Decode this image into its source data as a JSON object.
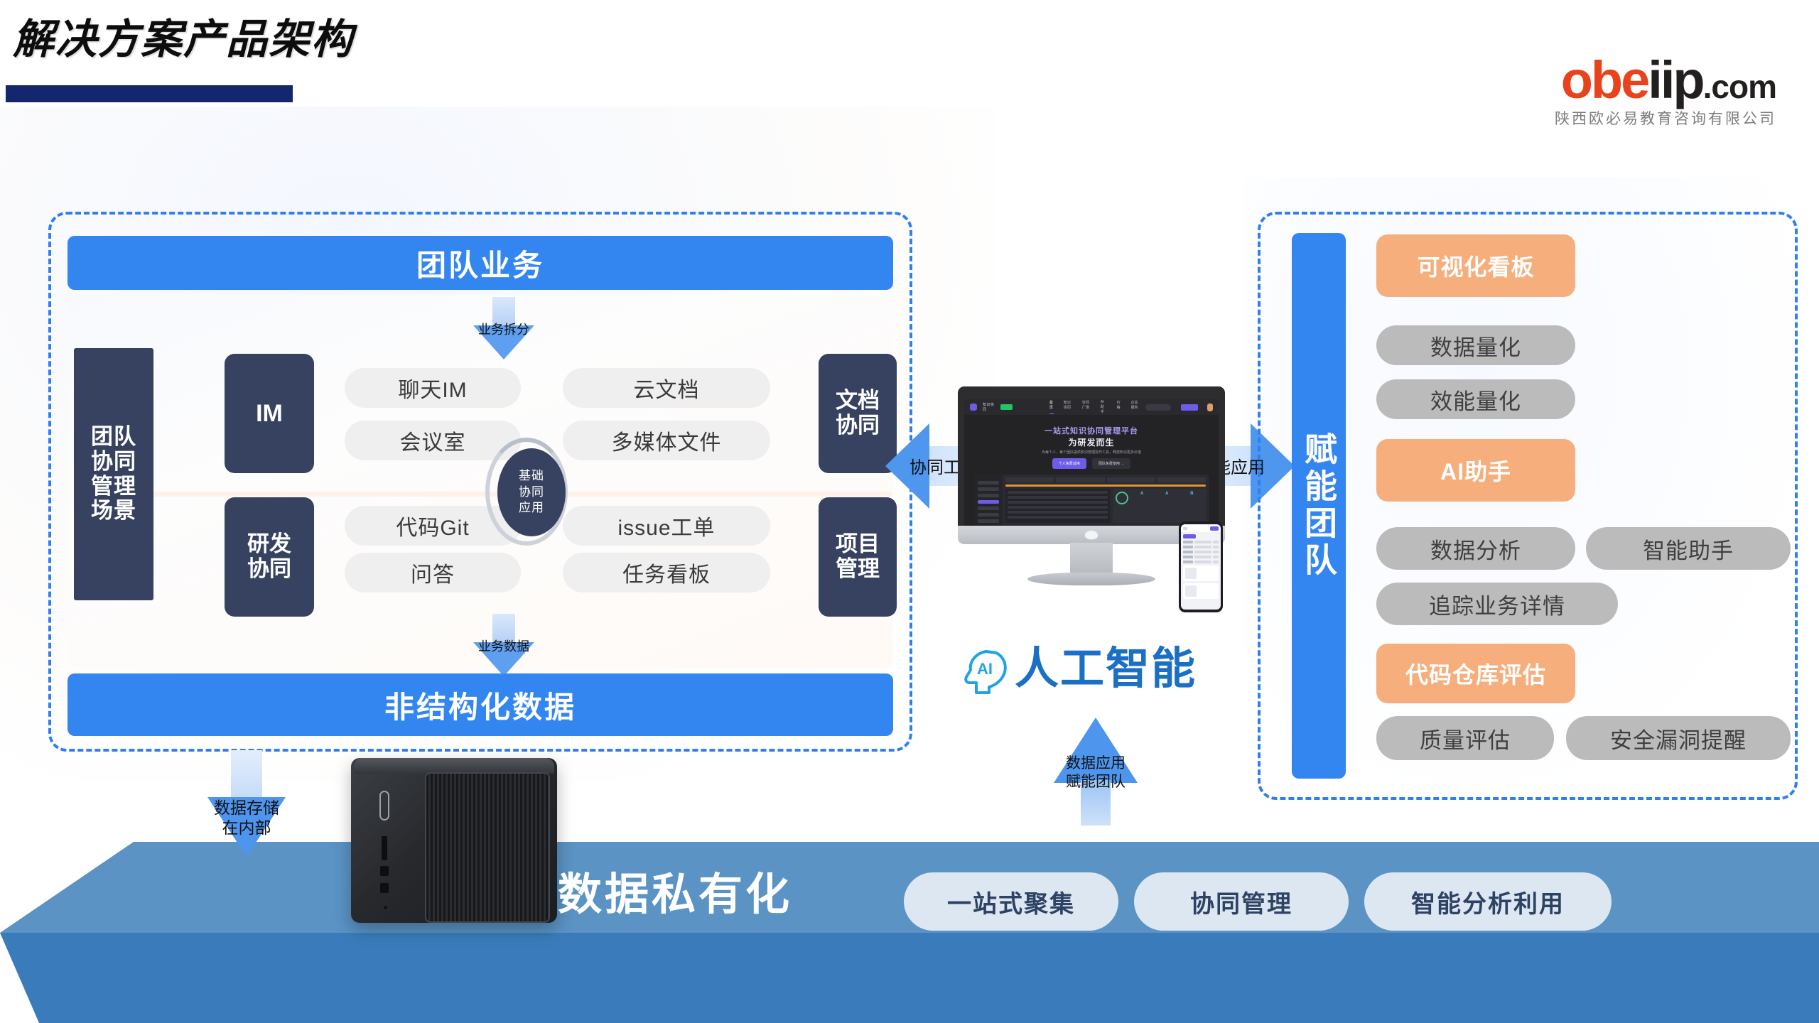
{
  "header": {
    "title": "解决方案产品架构",
    "logo": {
      "brand_orange": "obe",
      "brand_dark": "iip",
      "tld": ".com",
      "subtitle": "陕西欧必易教育咨询有限公司"
    }
  },
  "left_panel": {
    "top_bar": "团队业务",
    "bottom_bar": "非结构化数据",
    "scene_label": "团队协同管理场景",
    "core_circle": "基础协同应用",
    "categories": [
      {
        "name": "IM"
      },
      {
        "name": "研发协同"
      },
      {
        "name": "文档协同"
      },
      {
        "name": "项目管理"
      }
    ],
    "items": [
      {
        "label": "聊天IM"
      },
      {
        "label": "会议室"
      },
      {
        "label": "代码Git"
      },
      {
        "label": "问答"
      },
      {
        "label": "云文档"
      },
      {
        "label": "多媒体文件"
      },
      {
        "label": "issue工单"
      },
      {
        "label": "任务看板"
      }
    ],
    "arrow_split": "业务拆分",
    "arrow_bizdata": "业务数据"
  },
  "center": {
    "arrow_left": "协同工具",
    "arrow_right": "智能应用",
    "arrow_store": "数据存储\n在内部",
    "arrow_store_l1": "数据存储",
    "arrow_store_l2": "在内部",
    "arrow_ai_l1": "数据应用",
    "arrow_ai_l2": "赋能团队",
    "ai_badge": "AI",
    "ai_title": "人工智能",
    "monitor": {
      "headline_1": "一站式知识协同管理平台",
      "headline_2": "为研发而生",
      "subline": "为每个人、每个团队提供知识管理协作工具，释放知识更多价值",
      "btn_primary": "个人免费试用",
      "btn_secondary": "团队免费使用 →",
      "nav": [
        "首页",
        "知识协同",
        "空间广场",
        "AI助手",
        "价格",
        "企业服务"
      ]
    }
  },
  "right_panel": {
    "side_label": "赋能团队",
    "pills": [
      {
        "label": "可视化看板",
        "style": "orange"
      },
      {
        "label": "数据量化",
        "style": "gray"
      },
      {
        "label": "效能量化",
        "style": "gray"
      },
      {
        "label": "AI助手",
        "style": "orange"
      },
      {
        "label": "数据分析",
        "style": "gray"
      },
      {
        "label": "智能助手",
        "style": "gray"
      },
      {
        "label": "追踪业务详情",
        "style": "gray"
      },
      {
        "label": "代码仓库评估",
        "style": "orange"
      },
      {
        "label": "质量评估",
        "style": "gray"
      },
      {
        "label": "安全漏洞提醒",
        "style": "gray"
      }
    ]
  },
  "bottom": {
    "headline": "数据私有化",
    "pills": [
      {
        "label": "一站式聚集"
      },
      {
        "label": "协同管理"
      },
      {
        "label": "智能分析利用"
      }
    ]
  },
  "colors": {
    "accent_blue": "#3385f0",
    "navy": "#364260",
    "orange_pill": "#f5ae7c",
    "gray_pill": "#bbbbbb",
    "title_rule": "#14266e",
    "logo_orange": "#e8431c",
    "platform_light": "#5a93c4",
    "platform_dark": "#3a7cbb"
  }
}
